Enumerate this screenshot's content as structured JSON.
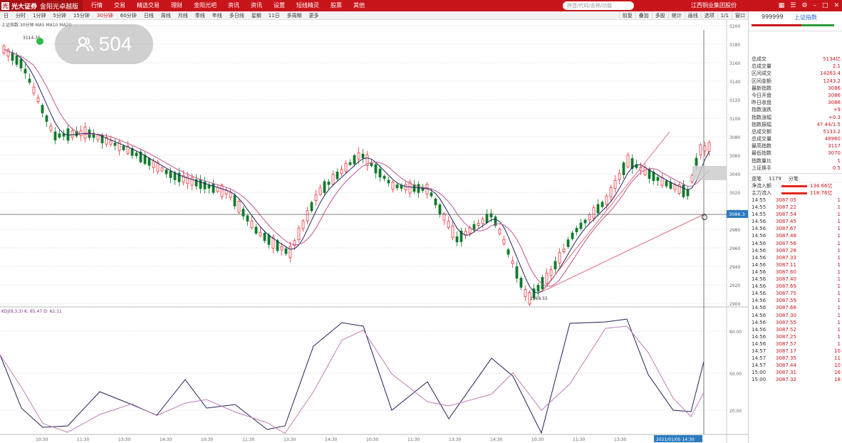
{
  "app": {
    "logo_text": "光大证券",
    "product_name": "金阳光卓越版",
    "menu": [
      "行情",
      "交易",
      "精选交易",
      "理财",
      "金阳光吧",
      "资讯",
      "资讯",
      "设置",
      "短线精灵",
      "股票",
      "其他"
    ],
    "search_placeholder": "拼音/代码/名称/功能",
    "top_right_text": "江西铜业集团股份",
    "window_controls": [
      "grid-icon",
      "menu-icon",
      "gear-icon",
      "minimize-icon",
      "maximize-icon",
      "close-icon"
    ]
  },
  "toolbar": {
    "periods": [
      "日",
      "分时",
      "1分钟",
      "5分钟",
      "15分钟",
      "30分钟",
      "60分钟",
      "日线",
      "周线",
      "月线",
      "季线",
      "年线",
      "多日线",
      "星期",
      "11日",
      "多周期",
      "更多"
    ],
    "active_index": 5,
    "right_buttons": [
      "前复",
      "叠加",
      "多股",
      "统计",
      "画线",
      "选项",
      "1/1",
      "窗口"
    ]
  },
  "chart": {
    "info_text": "上证指数 30分钟 MA5 MA10 MA20",
    "indicator_text": "KDJ(9,3,3)  K: 65.47  D: 62.11",
    "price_labels": [
      "3200",
      "3180",
      "3160",
      "3140",
      "3120",
      "3100",
      "3080",
      "3060",
      "3040",
      "3020",
      "3000",
      "2980",
      "2960",
      "2940",
      "2920",
      "2900"
    ],
    "current_price_tag": "3086.3",
    "high_label": "3114.35",
    "low_label": "2968.55",
    "indicator_labels": [
      "80.00",
      "50.00",
      "20.00"
    ],
    "time_labels": [
      "10:30",
      "11:30",
      "13:30",
      "14:30",
      "10:30",
      "11:30",
      "13:30",
      "14:30",
      "10:30",
      "11:30",
      "13:30",
      "14:30",
      "10:30",
      "11:30",
      "13:30",
      "14:30"
    ],
    "cursor_time_tag": "2021/01/05 14:30"
  },
  "viewer": {
    "count": "504",
    "icon": "people-icon"
  },
  "right_panel": {
    "code": "999999",
    "name": "上证指数",
    "stats": [
      {
        "k": "总成交",
        "v": "5134亿"
      },
      {
        "k": "总成交量",
        "v": "2.1"
      },
      {
        "k": "区间成交",
        "v": "14263.4"
      },
      {
        "k": "区间金额",
        "v": "1243.2"
      },
      {
        "k": "最新指数",
        "v": "3086"
      },
      {
        "k": "今日开盘",
        "v": "3086"
      },
      {
        "k": "昨日收盘",
        "v": "3086"
      },
      {
        "k": "指数涨跌",
        "v": "+9"
      },
      {
        "k": "指数涨幅",
        "v": "+0.3"
      },
      {
        "k": "指数振幅",
        "v": "47.44/1.5"
      },
      {
        "k": "总成交额",
        "v": "5133.2"
      },
      {
        "k": "总成交量",
        "v": "48960"
      },
      {
        "k": "最高指数",
        "v": "3117"
      },
      {
        "k": "最低指数",
        "v": "3070"
      },
      {
        "k": "指数量比",
        "v": "1"
      },
      {
        "k": "上证换手",
        "v": "0.5"
      }
    ],
    "flow_header": [
      "逐笔",
      "1179",
      "分笔"
    ],
    "flows": [
      {
        "k": "净流入额",
        "v": "134.66亿"
      },
      {
        "k": "主力流入",
        "v": "118.76亿"
      }
    ],
    "ticks": [
      {
        "t": "14:55",
        "p": "3087.05",
        "q": "1"
      },
      {
        "t": "14:55",
        "p": "3087.22",
        "q": "1"
      },
      {
        "t": "14:55",
        "p": "3087.54",
        "q": "1"
      },
      {
        "t": "14:56",
        "p": "3087.45",
        "q": "1"
      },
      {
        "t": "14:56",
        "p": "3087.67",
        "q": "1"
      },
      {
        "t": "14:56",
        "p": "3087.48",
        "q": "1"
      },
      {
        "t": "14:56",
        "p": "3087.56",
        "q": "1"
      },
      {
        "t": "14:56",
        "p": "3087.28",
        "q": "1"
      },
      {
        "t": "14:56",
        "p": "3087.33",
        "q": "1"
      },
      {
        "t": "14:56",
        "p": "3087.11",
        "q": "1"
      },
      {
        "t": "14:56",
        "p": "3087.60",
        "q": "1"
      },
      {
        "t": "14:56",
        "p": "3087.40",
        "q": "1"
      },
      {
        "t": "14:56",
        "p": "3087.69",
        "q": "1"
      },
      {
        "t": "14:56",
        "p": "3087.75",
        "q": "1"
      },
      {
        "t": "14:56",
        "p": "3087.59",
        "q": "1"
      },
      {
        "t": "14:56",
        "p": "3087.66",
        "q": "1"
      },
      {
        "t": "14:56",
        "p": "3087.30",
        "q": "1"
      },
      {
        "t": "14:56",
        "p": "3087.55",
        "q": "1"
      },
      {
        "t": "14:56",
        "p": "3087.52",
        "q": "1"
      },
      {
        "t": "14:56",
        "p": "3087.25",
        "q": "1"
      },
      {
        "t": "14:56",
        "p": "3087.57",
        "q": "1"
      },
      {
        "t": "14:57",
        "p": "3087.17",
        "q": "10"
      },
      {
        "t": "14:57",
        "p": "3087.35",
        "q": "11"
      },
      {
        "t": "14:57",
        "p": "3087.44",
        "q": "10"
      },
      {
        "t": "15:00",
        "p": "3087.31",
        "q": "16"
      },
      {
        "t": "15:00",
        "p": "3087.32",
        "q": "18"
      }
    ]
  }
}
